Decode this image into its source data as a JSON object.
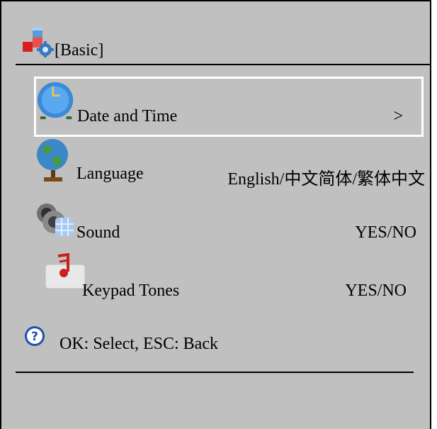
{
  "header": {
    "title": "[Basic]",
    "icon": "settings-blocks-icon"
  },
  "menu": [
    {
      "label": "Date and Time",
      "value": ">",
      "icon": "clock-icon",
      "selected": true
    },
    {
      "label": "Language",
      "value": "English/中文简体/繁体中文",
      "icon": "globe-icon",
      "selected": false
    },
    {
      "label": "Sound",
      "value": "YES/NO",
      "icon": "speaker-icon",
      "selected": false
    },
    {
      "label": "Keypad Tones",
      "value": "YES/NO",
      "icon": "music-note-icon",
      "selected": false
    }
  ],
  "footer": {
    "hint": "OK: Select, ESC: Back",
    "icon": "help-icon"
  },
  "colors": {
    "background": "#c0c0c0",
    "selection_border": "#ffffff",
    "text": "#000000"
  }
}
